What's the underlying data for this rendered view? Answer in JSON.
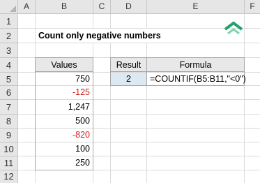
{
  "columns": [
    "A",
    "B",
    "C",
    "D",
    "E",
    "F"
  ],
  "rows": [
    "1",
    "2",
    "3",
    "4",
    "5",
    "6",
    "7",
    "8",
    "9",
    "10",
    "11",
    "12"
  ],
  "title": "Count only negative numbers",
  "values": {
    "header": "Values",
    "items": [
      "750",
      "-125",
      "1,247",
      "500",
      "-820",
      "100",
      "250"
    ],
    "negative_items": [
      false,
      true,
      false,
      false,
      true,
      false,
      false
    ]
  },
  "result": {
    "header": "Result",
    "value": "2"
  },
  "formula": {
    "header": "Formula",
    "value": "=COUNTIF(B5:B11,\"<0\")"
  },
  "colors": {
    "negative_text": "#d11f1f",
    "result_fill": "#dde8f3",
    "header_fill": "#e8e8e8",
    "logo": "#1fa36a"
  },
  "icons": {
    "logo": "chevron-up-logo-icon"
  }
}
